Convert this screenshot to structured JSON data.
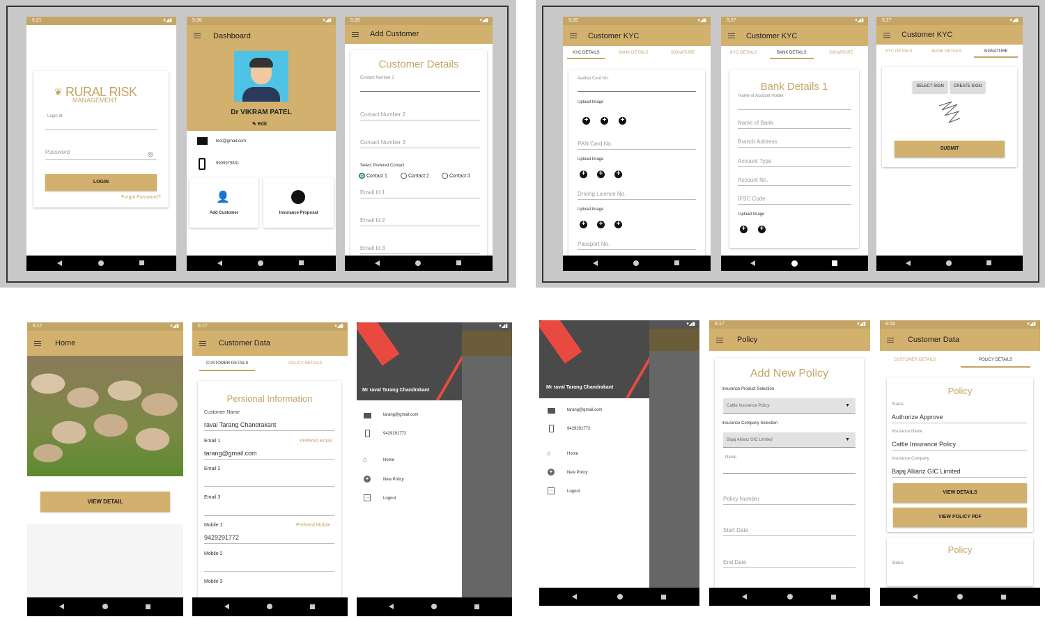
{
  "status": {
    "t521": "5:21",
    "t526": "5:26",
    "t527": "5:27",
    "t617": "6:17",
    "t618": "6:18"
  },
  "login": {
    "logo_line1": "RURAL RISK",
    "logo_line2": "MANAGEMENT",
    "login_id": "Login Id",
    "password": "Password",
    "login_btn": "LOGIN",
    "forgot": "Forgot Password?"
  },
  "dashboard": {
    "title": "Dashboard",
    "name": "Dr VIKRAM PATEL",
    "edit": "Edit",
    "email": "test@gmail.com",
    "phone": "9909975831",
    "add_customer": "Add Customer",
    "insurance_proposal": "Insurance Proposal"
  },
  "add_customer": {
    "title": "Add Customer",
    "heading": "Customer Details",
    "contact1": "Contact Number 1",
    "contact2": "Contact Number 2",
    "contact3": "Contact Number 3",
    "select_pref": "Select Prefered Contact",
    "radio": [
      "Contact 1",
      "Contact 2",
      "Contact 3"
    ],
    "email1": "Email Id 1",
    "email2": "Email Id 2",
    "email3": "Email Id 3"
  },
  "kyc": {
    "title": "Customer KYC",
    "tabs": [
      "KYC DETAILS",
      "BANK DETAILS",
      "SIGNATURE"
    ],
    "aadhar": "Aadhar Card No.",
    "upload": "Upload Image",
    "pan": "PAN Card No.",
    "driving": "Driving Licence No.",
    "passport": "Passport No.",
    "bank_heading": "Bank Details 1",
    "holder": "Name of Account Holder",
    "bank_name": "Name of Bank",
    "branch": "Branch Address",
    "acc_type": "Account Type",
    "acc_no": "Account No.",
    "ifsc": "IFSC Code",
    "select_sign": "SELECT SIGN",
    "create_sign": "CREATE SIGN",
    "submit": "SUBMIT"
  },
  "home": {
    "title": "Home",
    "view_detail": "VIEW DETAIL"
  },
  "customer_data": {
    "title": "Customer Data",
    "tabs": [
      "CUSTOMER DETAILS",
      "POLICY DETAILS"
    ],
    "heading": "Persional Information",
    "name_label": "Customer Name",
    "name_value": "raval Tarang Chandrakant",
    "email1": "Email 1",
    "pref_email": "Prefered Email",
    "email1_value": "tarang@gmail.com",
    "email2": "Email 2",
    "email3": "Email 3",
    "mobile1": "Mobile 1",
    "pref_mobile": "Prefered Mobile",
    "mobile1_value": "9429291772",
    "mobile2": "Mobile 2",
    "mobile3": "Mobile 3"
  },
  "drawer": {
    "name": "Mr raval Tarang Chandrakant",
    "email": "tarang@gmail.com",
    "phone": "9429291772",
    "home": "Home",
    "new_policy": "New Policy",
    "logout": "Logout"
  },
  "policy": {
    "title": "Policy",
    "heading": "Add New Policy",
    "product_label": "Insurance Product Selection",
    "product_value": "Cattle Insurance Policy",
    "company_label": "Insurance Company Selection",
    "company_value": "Bajaj Allianz GIC Limited",
    "name": "Name",
    "policy_number": "Policy Number",
    "start_date": "Start Date",
    "end_date": "End Date"
  },
  "policy_details": {
    "heading": "Policy",
    "status_label": "Status",
    "status_value": "Authorize Approve",
    "ins_name_label": "Insurance Name",
    "ins_name_value": "Cattle Insurance Policy",
    "ins_company_label": "Insurance Company",
    "ins_company_value": "Bajaj Allianz GIC Limited",
    "view_details": "VIEW DETAILS",
    "view_pdf": "VIEW POLICY PDF",
    "heading2": "Policy",
    "status_label2": "Status"
  },
  "colors": {
    "gold": "#d2b06e",
    "gold_text": "#c5a566",
    "dark": "#4a4a4a",
    "red": "#e94a3f"
  }
}
